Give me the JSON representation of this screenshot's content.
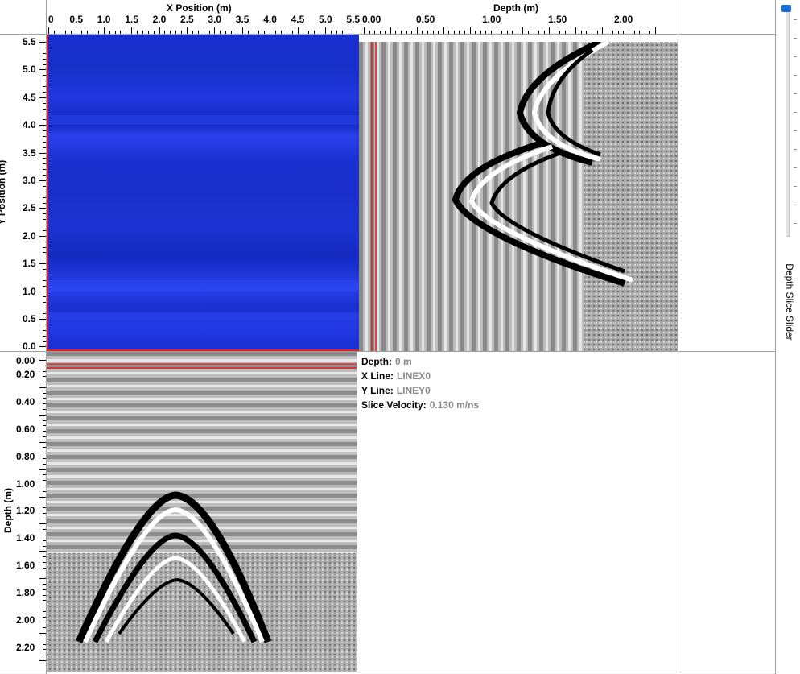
{
  "x_axis": {
    "title": "X Position (m)",
    "ticks": [
      "0",
      "0.5",
      "1.0",
      "1.5",
      "2.0",
      "2.5",
      "3.0",
      "3.5",
      "4.0",
      "4.5",
      "5.0",
      "5.5"
    ]
  },
  "y_axis": {
    "title": "Y Position (m)",
    "ticks": [
      "5.5",
      "5.0",
      "4.5",
      "4.0",
      "3.5",
      "3.0",
      "2.5",
      "2.0",
      "1.5",
      "1.0",
      "0.5",
      "0.0"
    ]
  },
  "depth_top_axis": {
    "title": "Depth (m)",
    "ticks": [
      "0.00",
      "0.50",
      "1.00",
      "1.50",
      "2.00"
    ]
  },
  "depth_left_axis": {
    "title": "Depth (m)",
    "ticks": [
      "0.00",
      "0.20",
      "0.40",
      "0.60",
      "0.80",
      "1.00",
      "1.20",
      "1.40",
      "1.60",
      "1.80",
      "2.00",
      "2.20"
    ]
  },
  "info": {
    "depth_label": "Depth:",
    "depth_value": "0 m",
    "xline_label": "X Line:",
    "xline_value": "LINEX0",
    "yline_label": "Y Line:",
    "yline_value": "LINEY0",
    "velocity_label": "Slice Velocity:",
    "velocity_value": "0.130 m/ns"
  },
  "slider": {
    "label": "Depth Slice Slider",
    "position": 0.0
  },
  "colors": {
    "slice_blue": "#1a2fd8",
    "cursor_red": "#e02020",
    "slider_thumb": "#1a6fd8"
  }
}
